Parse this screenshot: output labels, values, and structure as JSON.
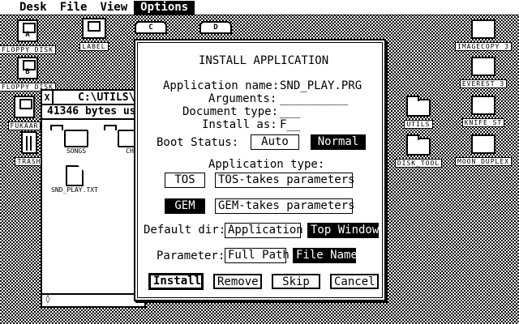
{
  "menubar": {
    "items": [
      {
        "label": "Desk"
      },
      {
        "label": "File"
      },
      {
        "label": "View"
      },
      {
        "label": "Options"
      }
    ]
  },
  "desktop": {
    "icons": [
      {
        "label": "FLOPPY DISK",
        "letter": "A"
      },
      {
        "label": "LABEL",
        "letter": ""
      },
      {
        "label": "FLOPPY DISK",
        "letter": "B"
      },
      {
        "label": "FUKAAR",
        "letter": ""
      },
      {
        "label": "TRASH",
        "letter": ""
      },
      {
        "label": "IMAGECOPY 3",
        "letter": ""
      },
      {
        "label": "EVEREST 3",
        "letter": ""
      },
      {
        "label": "UTILS",
        "letter": ""
      },
      {
        "label": "KNIFE ST",
        "letter": ""
      },
      {
        "label": "DISK_TOOL",
        "letter": ""
      },
      {
        "label": "MOON_DUPLEX",
        "letter": ""
      },
      {
        "label": "C",
        "letter": "C"
      },
      {
        "label": "D",
        "letter": "D"
      }
    ]
  },
  "window": {
    "close": "X",
    "title": "C:\\UTILS\\",
    "info": "41346 bytes us",
    "files": [
      {
        "name": "SONGS"
      },
      {
        "name": "CH"
      },
      {
        "name": "SND_PLAY.TXT"
      }
    ],
    "scroll_arrow": "◊"
  },
  "dialog": {
    "title": "INSTALL APPLICATION",
    "app_name_label": "Application name:",
    "app_name_value": "SND_PLAY.PRG",
    "arguments_label": "Arguments:",
    "arguments_value": "__________",
    "doc_type_label": "Document type:",
    "doc_type_value": "___",
    "install_as_label": "Install as:",
    "install_as_value": "F__",
    "boot_status_label": "Boot Status:",
    "boot_auto": "Auto",
    "boot_normal": "Normal",
    "app_type_label": "Application type:",
    "type_tos": "TOS",
    "type_tos_params": "TOS-takes parameters",
    "type_gem": "GEM",
    "type_gem_params": "GEM-takes parameters",
    "default_dir_label": "Default dir:",
    "dir_application": "Application",
    "dir_top_window": "Top Window",
    "parameter_label": "Parameter:",
    "param_full_path": "Full Path",
    "param_file_name": "File Name",
    "btn_install": "Install",
    "btn_remove": "Remove",
    "btn_skip": "Skip",
    "btn_cancel": "Cancel"
  }
}
